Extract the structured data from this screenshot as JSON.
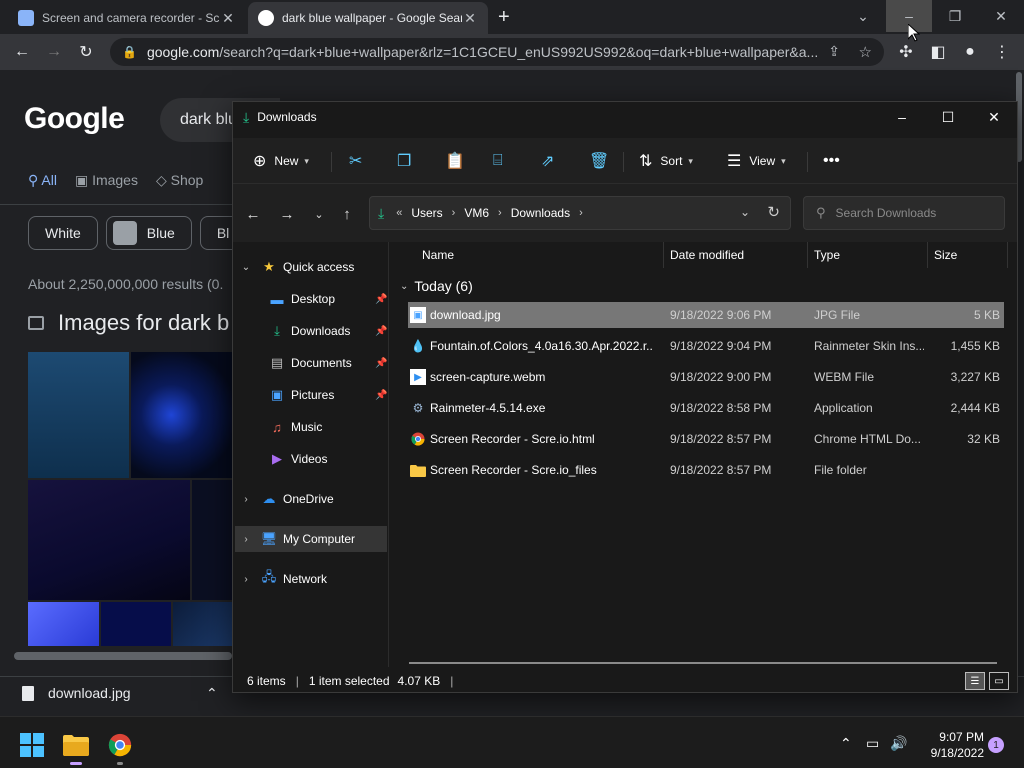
{
  "browser": {
    "tabs": [
      {
        "title": "Screen and camera recorder - Scre"
      },
      {
        "title": "dark blue wallpaper - Google Sear"
      }
    ],
    "address": {
      "host": "google.com",
      "path": "/search?q=dark+blue+wallpaper&rlz=1C1GCEU_enUS992US992&oq=dark+blue+wallpaper&a..."
    }
  },
  "google": {
    "logo": "Google",
    "query": "dark blu",
    "tabs": [
      "All",
      "Images",
      "Shop"
    ],
    "chips": [
      "White",
      "Blue",
      "Bl"
    ],
    "result_count": "About 2,250,000,000 results (0.",
    "images_title": "Images for dark b"
  },
  "download_shelf": {
    "filename": "download.jpg"
  },
  "explorer": {
    "title": "Downloads",
    "commands": {
      "new": "New",
      "sort": "Sort",
      "view": "View"
    },
    "breadcrumb": [
      "Users",
      "VM6",
      "Downloads"
    ],
    "search_placeholder": "Search Downloads",
    "nav": {
      "quick_access": "Quick access",
      "pinned": [
        "Desktop",
        "Downloads",
        "Documents",
        "Pictures"
      ],
      "unpinned": [
        "Music",
        "Videos"
      ],
      "onedrive": "OneDrive",
      "my_computer": "My Computer",
      "network": "Network"
    },
    "columns": {
      "name": "Name",
      "date": "Date modified",
      "type": "Type",
      "size": "Size"
    },
    "group_label": "Today (6)",
    "files": [
      {
        "name": "download.jpg",
        "date": "9/18/2022 9:06 PM",
        "type": "JPG File",
        "size": "5 KB",
        "icon": "jpg-file-icon"
      },
      {
        "name": "Fountain.of.Colors_4.0a16.30.Apr.2022.r...",
        "date": "9/18/2022 9:04 PM",
        "type": "Rainmeter Skin Ins...",
        "size": "1,455 KB",
        "icon": "rainmeter-skin-icon"
      },
      {
        "name": "screen-capture.webm",
        "date": "9/18/2022 9:00 PM",
        "type": "WEBM File",
        "size": "3,227 KB",
        "icon": "webm-file-icon"
      },
      {
        "name": "Rainmeter-4.5.14.exe",
        "date": "9/18/2022 8:58 PM",
        "type": "Application",
        "size": "2,444 KB",
        "icon": "installer-icon"
      },
      {
        "name": "Screen Recorder - Scre.io.html",
        "date": "9/18/2022 8:57 PM",
        "type": "Chrome HTML Do...",
        "size": "32 KB",
        "icon": "chrome-html-icon"
      },
      {
        "name": "Screen Recorder - Scre.io_files",
        "date": "9/18/2022 8:57 PM",
        "type": "File folder",
        "size": "",
        "icon": "folder-icon"
      }
    ],
    "status": {
      "count": "6 items",
      "selection": "1 item selected",
      "size": "4.07 KB"
    }
  },
  "taskbar": {
    "time": "9:07 PM",
    "date": "9/18/2022",
    "notifications": "1"
  }
}
